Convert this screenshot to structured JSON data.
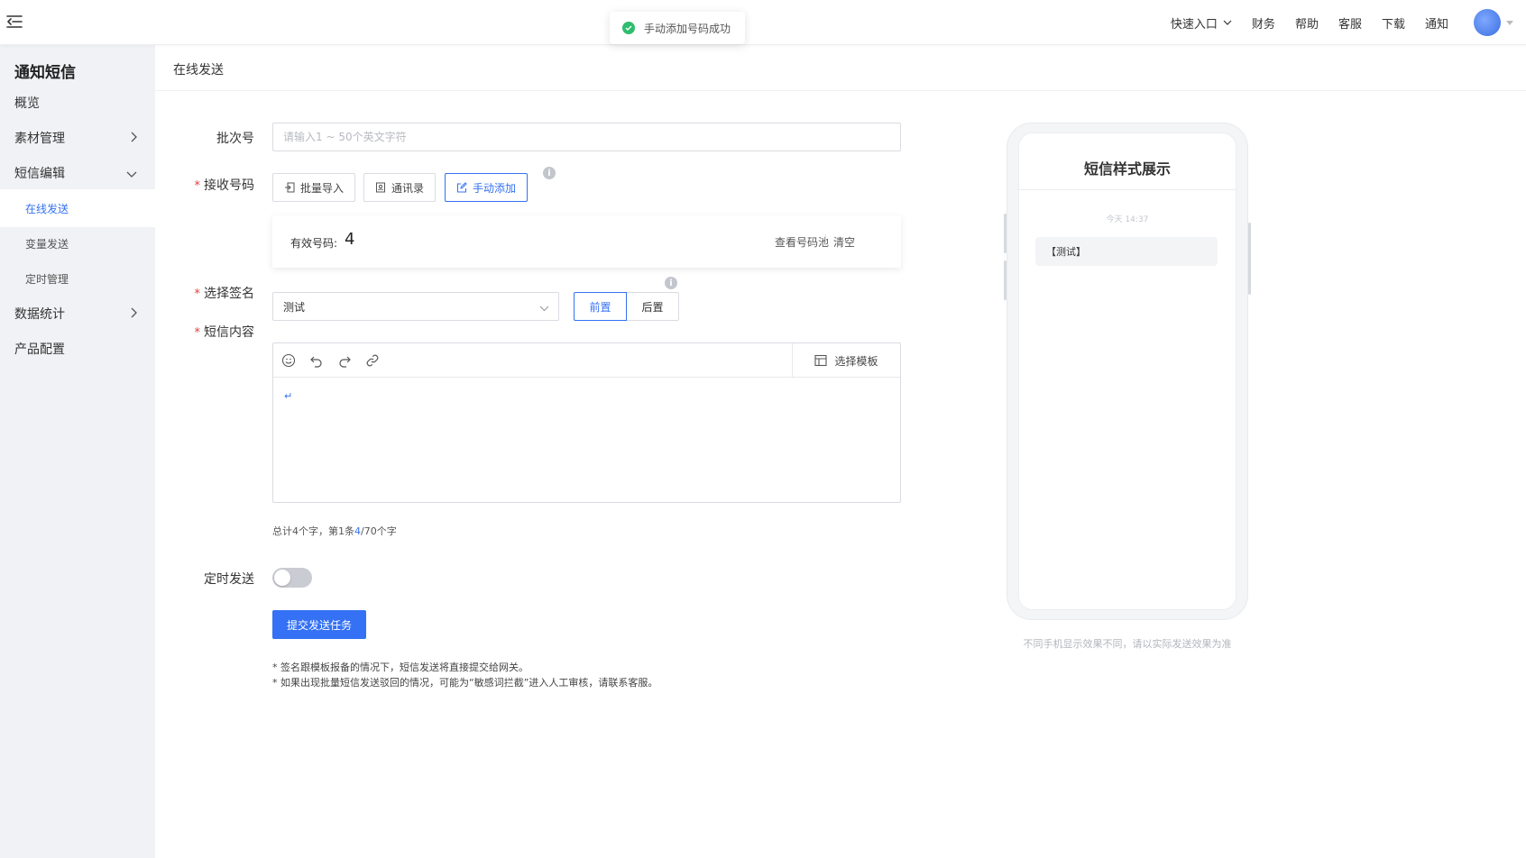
{
  "header": {
    "nav_items": [
      "快速入口",
      "财务",
      "帮助",
      "客服",
      "下载",
      "通知"
    ]
  },
  "toast": {
    "message": "手动添加号码成功"
  },
  "sidebar": {
    "title": "通知短信",
    "items": [
      {
        "label": "概览"
      },
      {
        "label": "素材管理"
      },
      {
        "label": "短信编辑"
      },
      {
        "label": "在线发送"
      },
      {
        "label": "变量发送"
      },
      {
        "label": "定时管理"
      },
      {
        "label": "数据统计"
      },
      {
        "label": "产品配置"
      }
    ]
  },
  "page": {
    "title": "在线发送"
  },
  "form": {
    "batch": {
      "label": "批次号",
      "placeholder": "请输入1 ~ 50个英文字符"
    },
    "receiver": {
      "required_mark": "*",
      "label": "接收号码",
      "buttons": {
        "batch_import": "批量导入",
        "contacts": "通讯录",
        "manual_add": "手动添加"
      },
      "valid_label": "有效号码:",
      "valid_count": "4",
      "view_pool": "查看号码池",
      "clear": "清空"
    },
    "signature": {
      "required_mark": "*",
      "label": "选择签名",
      "selected": "测试",
      "position_options": {
        "front": "前置",
        "back": "后置"
      },
      "position_selected": "前置"
    },
    "content": {
      "required_mark": "*",
      "label": "短信内容",
      "template_button": "选择模板",
      "editor_text": "↵",
      "count_prefix": "总计4个字，第1条",
      "count_current": "4",
      "count_suffix": "/70个字"
    },
    "schedule": {
      "label": "定时发送",
      "enabled": false
    },
    "submit_label": "提交发送任务",
    "notes": [
      "* 签名跟模板报备的情况下，短信发送将直接提交给网关。",
      "* 如果出现批量短信发送驳回的情况，可能为“敏感词拦截”进入人工审核，请联系客服。"
    ]
  },
  "preview": {
    "title": "短信样式展示",
    "time": "今天 14:37",
    "message": "【测试】",
    "note": "不同手机显示效果不同，请以实际发送效果为准"
  },
  "colors": {
    "primary": "#3471f4",
    "success": "#2fbd6e",
    "required": "#e83a3a",
    "sidebar_bg": "#f0f2f5"
  },
  "icons": [
    "menu-toggle-icon",
    "check-circle-icon",
    "chevron-down-icon",
    "chevron-right-icon",
    "import-icon",
    "contacts-icon",
    "edit-icon",
    "info-icon",
    "emoji-icon",
    "undo-icon",
    "redo-icon",
    "link-icon",
    "template-icon"
  ]
}
